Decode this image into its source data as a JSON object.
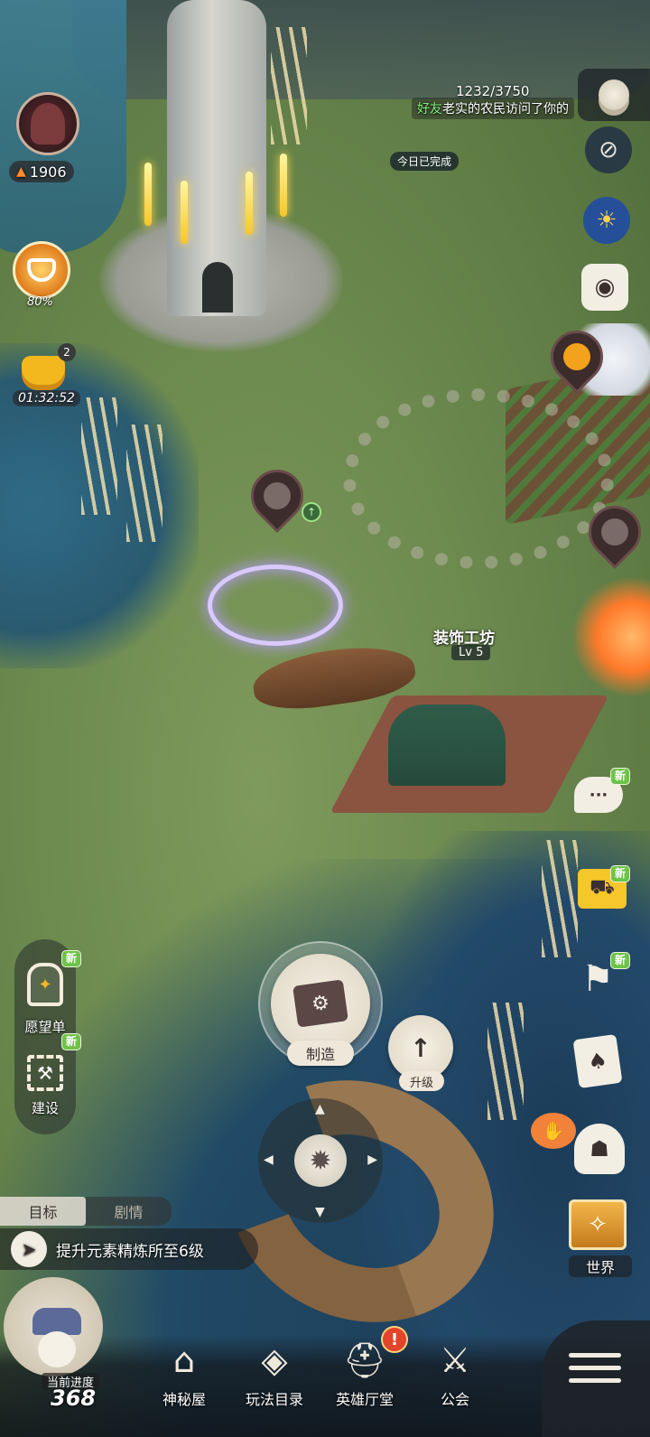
{
  "player": {
    "power": "1906",
    "buff_percent": "80%",
    "bag_count": "2",
    "bag_timer": "01:32:52"
  },
  "hud": {
    "visitors": "1232/3750",
    "ticker_highlight": "好友",
    "ticker_text": "老实的农民访问了你的",
    "today_done": "今日已完成"
  },
  "building": {
    "name": "装饰工坊",
    "level": "Lv 5"
  },
  "left_panel": {
    "wishlist_label": "愿望单",
    "build_label": "建设",
    "new_badge": "新"
  },
  "actions": {
    "craft_label": "制造",
    "upgrade_label": "升级"
  },
  "right_panel": {
    "new_badge": "新",
    "world_label": "世界"
  },
  "quest": {
    "tab_goal": "目标",
    "tab_story": "剧情",
    "text": "提升元素精炼所至6级"
  },
  "progress": {
    "label": "当前进度",
    "value": "368"
  },
  "nav": {
    "items": [
      {
        "label": "神秘屋",
        "icon": "mystery-house-icon"
      },
      {
        "label": "玩法目录",
        "icon": "gameplay-catalog-icon"
      },
      {
        "label": "英雄厅堂",
        "icon": "hero-hall-icon"
      },
      {
        "label": "公会",
        "icon": "guild-icon"
      }
    ],
    "alert": "!"
  }
}
